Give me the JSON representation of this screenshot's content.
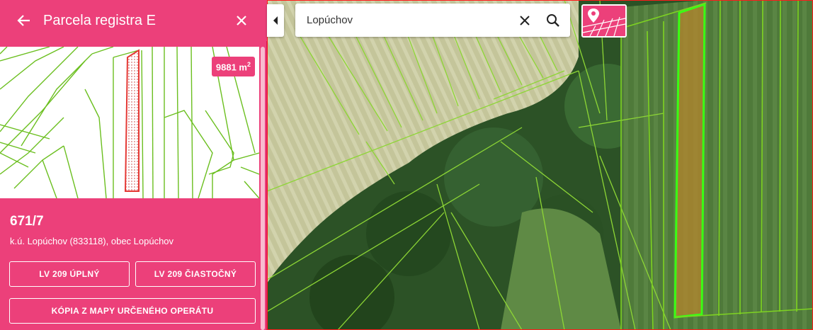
{
  "panel": {
    "title": "Parcela registra E",
    "back_icon": "arrow-left-icon",
    "close_icon": "close-icon",
    "area_value": "9881 m",
    "area_unit_sup": "2",
    "parcel_number": "671/7",
    "location": "k.ú. Lopúchov (833118), obec Lopúchov",
    "buttons": {
      "lv_full": "LV 209 ÚPLNÝ",
      "lv_partial": "LV 209 ČIASTOČNÝ",
      "copy_map": "KÓPIA Z MAPY URČENÉHO OPERÁTU"
    }
  },
  "search": {
    "value": "Lopúchov",
    "clear_icon": "close-icon",
    "search_icon": "search-icon"
  },
  "map": {
    "collapse_icon": "chevron-left-icon",
    "layer_icon": "map-layer-pin-icon"
  },
  "colors": {
    "accent": "#ec407a",
    "parcel_line": "#7ed321",
    "highlight": "#b5852e"
  }
}
